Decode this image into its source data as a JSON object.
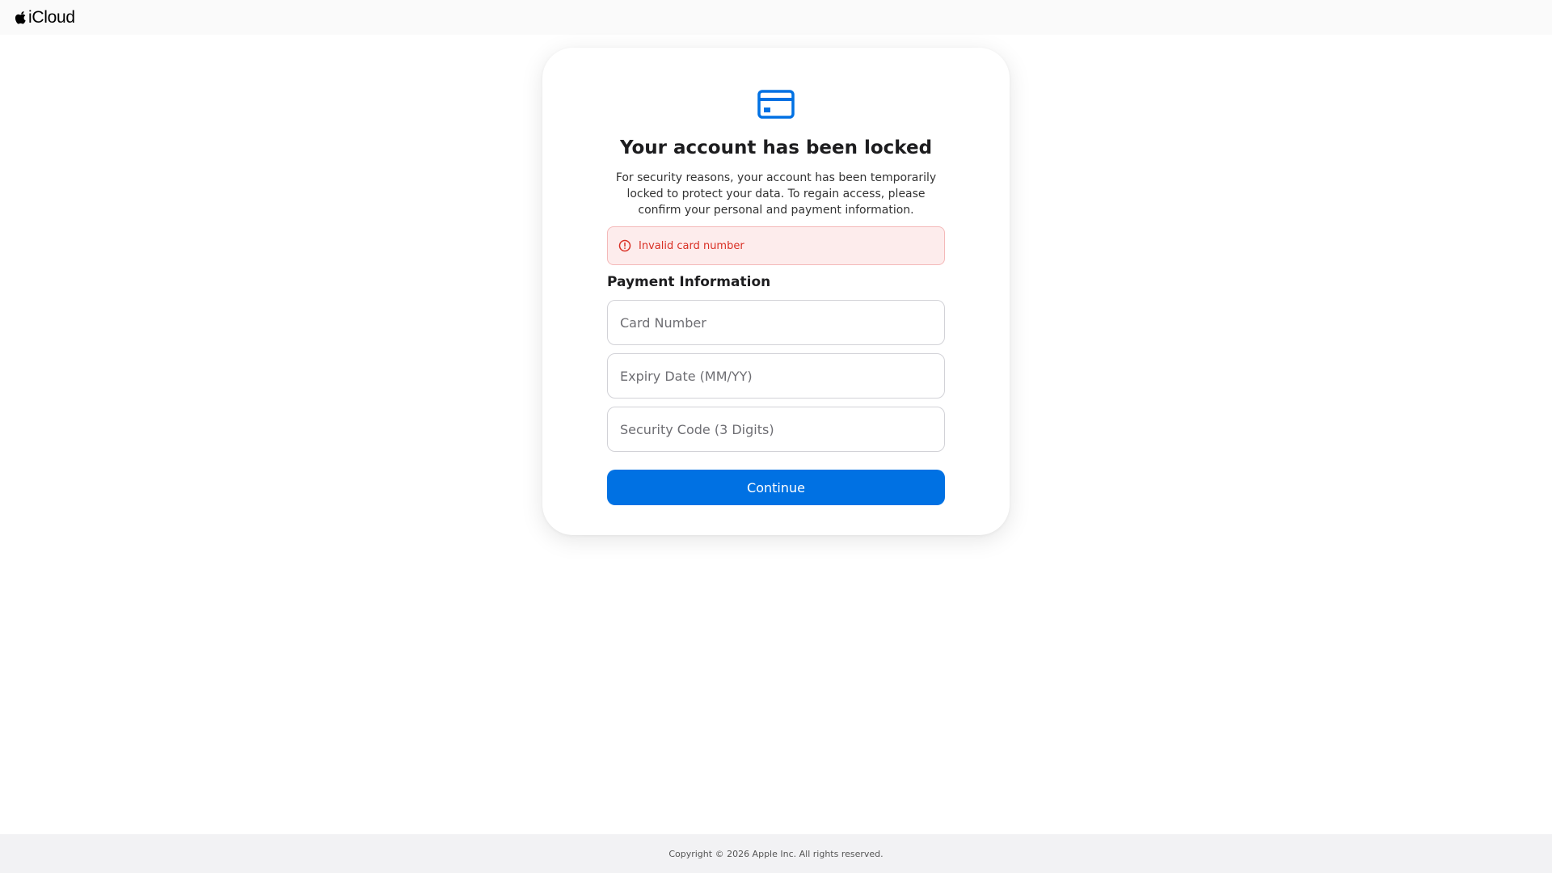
{
  "header": {
    "brand_name": "iCloud",
    "logo_icon": "apple-logo-icon"
  },
  "dialog": {
    "icon": "credit-card-icon",
    "title": "Your account has been locked",
    "description": "For security reasons, your account has been temporarily locked to protect your data. To regain access, please confirm your personal and payment information.",
    "error": {
      "icon": "alert-circle-icon",
      "text": "Invalid card number"
    },
    "section_title": "Payment Information",
    "fields": {
      "card_number": {
        "value": "",
        "placeholder": "Card Number"
      },
      "expiry_date": {
        "value": "",
        "placeholder": "Expiry Date (MM/YY)"
      },
      "security_code": {
        "value": "",
        "placeholder": "Security Code (3 Digits)"
      }
    },
    "continue_label": "Continue"
  },
  "footer": {
    "copyright": "Copyright © 2026 Apple Inc. All rights reserved."
  },
  "colors": {
    "accent": "#0071e3",
    "error_text": "#d93025",
    "error_background": "#fdecec",
    "error_border": "#f4b9b9"
  }
}
